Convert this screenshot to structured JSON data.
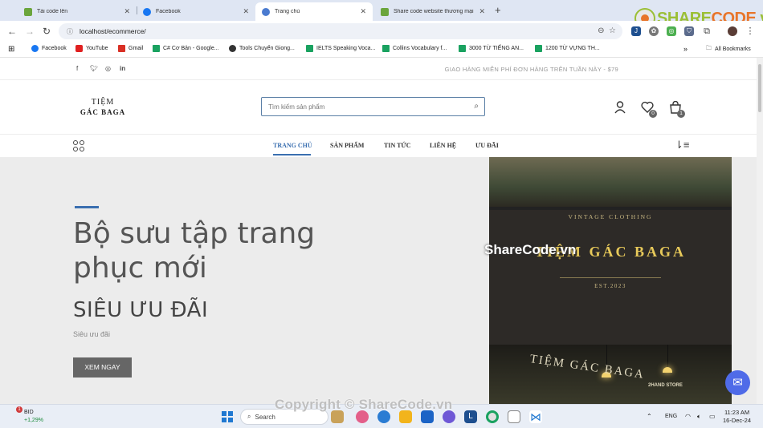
{
  "browser": {
    "tabs": [
      {
        "label": "Tải code lên",
        "color": "#6ba53c"
      },
      {
        "label": "Facebook",
        "color": "#1877f2"
      },
      {
        "label": "Trang chủ",
        "color": "#4a7bd0"
      },
      {
        "label": "Share code website thương mại",
        "color": "#6ba53c"
      }
    ],
    "url": "localhost/ecommerce/",
    "bookmarks": [
      {
        "label": "Facebook",
        "color": "#1877f2"
      },
      {
        "label": "YouTube",
        "color": "#e02020"
      },
      {
        "label": "Gmail",
        "color": "#d93025"
      },
      {
        "label": "C# Cơ Bản - Google...",
        "color": "#1aa260"
      },
      {
        "label": "Tools Chuyển Giong...",
        "color": "#333333"
      },
      {
        "label": "IELTS Speaking Voca...",
        "color": "#1aa260"
      },
      {
        "label": "Collins Vocabulary f...",
        "color": "#1aa260"
      },
      {
        "label": "3000 TỪ TIẾNG AN...",
        "color": "#1aa260"
      },
      {
        "label": "1200 TỪ VỰNG TH...",
        "color": "#1aa260"
      }
    ],
    "all_bookmarks": "All Bookmarks"
  },
  "site": {
    "promo": "GIAO HÀNG MIỄN PHÍ ĐƠN HÀNG TRÊN TUẦN NÀY - $79",
    "logo_line1": "TIỆM",
    "logo_line2": "GÁC BAGA",
    "search_placeholder": "Tìm kiếm sản phẩm",
    "wishlist_count": "0",
    "cart_count": "1",
    "menu": [
      "TRANG CHỦ",
      "SẢN PHẨM",
      "TIN TỨC",
      "LIÊN HỆ",
      "ƯU ĐÃI"
    ],
    "hero": {
      "title": "Bộ sưu tập trang phục mới",
      "subtitle": "SIÊU ƯU ĐÃI",
      "small": "Siêu ưu đãi",
      "button": "XEM NGAY",
      "photo_vintage": "VINTAGE CLOTHING",
      "photo_name": "TIỆM GÁC BAGA",
      "photo_est": "EST.2023",
      "photo_store": "TIỆM GÁC BAGA",
      "photo_2hand": "2HAND STORE"
    }
  },
  "watermarks": {
    "sharecode_logo": "SHARECODE.vn",
    "mid": "ShareCode.vn",
    "copyright": "Copyright © ShareCode.vn"
  },
  "taskbar": {
    "stock_name": "BID",
    "stock_change": "+1,29%",
    "stock_badge": "1",
    "search": "Search",
    "lang": "ENG",
    "time": "11:23 AM",
    "date": "16-Dec-24"
  }
}
